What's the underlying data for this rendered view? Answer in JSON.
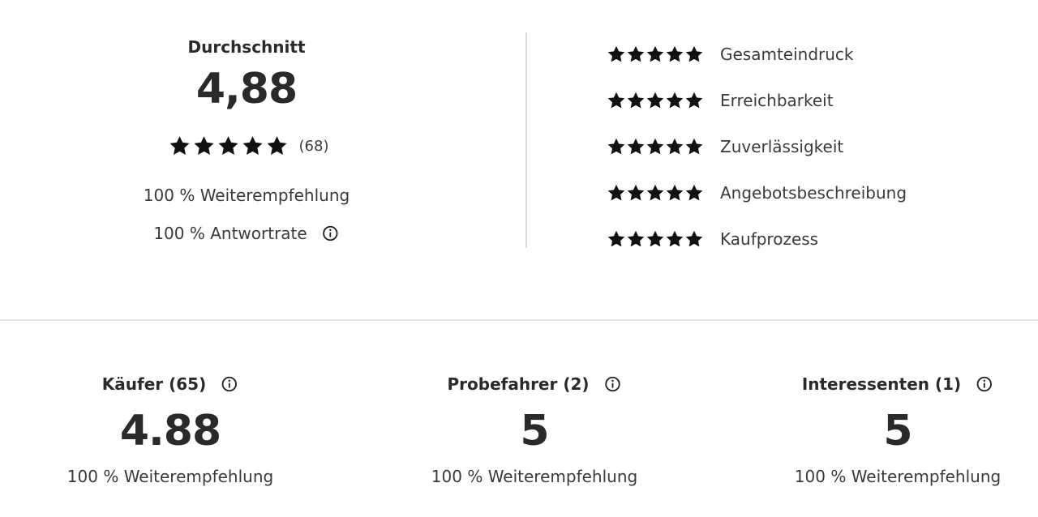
{
  "summary": {
    "title": "Durchschnitt",
    "average": "4,88",
    "stars": 5,
    "count": "(68)",
    "recommendation": "100 % Weiterempfehlung",
    "response_rate": "100 % Antwortrate",
    "info_icon": "info-circle-icon"
  },
  "categories": [
    {
      "label": "Gesamteindruck",
      "stars": 5
    },
    {
      "label": "Erreichbarkeit",
      "stars": 5
    },
    {
      "label": "Zuverlässigkeit",
      "stars": 5
    },
    {
      "label": "Angebotsbeschreibung",
      "stars": 5
    },
    {
      "label": "Kaufprozess",
      "stars": 5
    }
  ],
  "groups": [
    {
      "title": "Käufer (65)",
      "value": "4.88",
      "recommendation": "100 % Weiterempfehlung"
    },
    {
      "title": "Probefahrer (2)",
      "value": "5",
      "recommendation": "100 % Weiterempfehlung"
    },
    {
      "title": "Interessenten (1)",
      "value": "5",
      "recommendation": "100 % Weiterempfehlung"
    }
  ],
  "colors": {
    "text": "#2a2a2a",
    "star": "#111111",
    "divider": "#dcdcdc"
  }
}
